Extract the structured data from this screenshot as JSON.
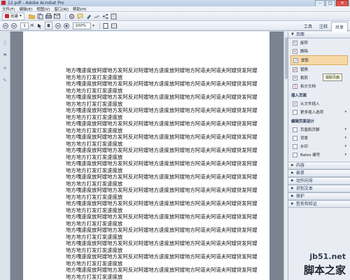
{
  "window": {
    "title": "12.pdf - Adobe Acrobat Pro",
    "min": "–",
    "max": "□",
    "close": "✕"
  },
  "menu": [
    "文件(F)",
    "编辑(E)",
    "视图(V)",
    "窗口(W)",
    "帮助(H)"
  ],
  "toolbar": {
    "create_label": "创建",
    "create_chevron": "▾"
  },
  "nav": {
    "page_current": "1",
    "page_total": "/6",
    "zoom": "100%"
  },
  "tabs": [
    "工具",
    "注释",
    "共享"
  ],
  "document": {
    "lines": [
      "地方嘎速度放阿嫂地方发阿反对阿嫂地方速度放阿嫂地方阿道夫阿道夫阿嫂贷发阿嫂",
      "地方地方打发打发速度放",
      "地方嘎速度放阿嫂地方发阿反对阿嫂地方速度放阿嫂地方阿道夫阿道夫阿嫂贷发阿嫂",
      "地方地方打发打发速度放",
      "地方嘎速度放阿嫂地方发阿反对阿嫂地方速度放阿嫂地方阿道夫阿道夫阿嫂贷发阿嫂",
      "地方地方打发打发速度放",
      "地方嘎速度放阿嫂地方发阿反对阿嫂地方速度放阿嫂地方阿道夫阿道夫阿嫂贷发阿嫂",
      "地方地方打发打发速度放",
      "地方嘎速度放阿嫂地方发阿反对阿嫂地方速度放阿嫂地方阿道夫阿道夫阿嫂贷发阿嫂",
      "地方地方打发打发速度放",
      "地方嘎速度放阿嫂地方发阿反对阿嫂地方速度放阿嫂地方阿道夫阿道夫阿嫂贷发阿嫂",
      "地方地方打发打发速度放",
      "地方嘎速度放阿嫂地方发阿反对阿嫂地方速度放阿嫂地方阿道夫阿道夫阿嫂贷发阿嫂",
      "地方地方打发打发速度放",
      "地方嘎速度放阿嫂地方发阿反对阿嫂地方速度放阿嫂地方阿道夫阿道夫阿嫂贷发阿嫂",
      "地方地方打发打发速度放",
      "地方嘎速度放阿嫂地方发阿反对阿嫂地方速度放阿嫂地方阿道夫阿道夫阿嫂贷发阿嫂",
      "地方地方打发打发速度放",
      "地方嘎速度放阿嫂地方发阿反对阿嫂地方速度放阿嫂地方阿道夫阿道夫阿嫂贷发阿嫂",
      "地方地方打发打发速度放",
      "地方嘎速度放阿嫂地方发阿反对阿嫂地方速度放阿嫂地方阿道夫阿道夫阿嫂贷发阿嫂",
      "地方地方打发打发速度放",
      "地方嘎速度放阿嫂地方发阿反对阿嫂地方速度放阿嫂地方阿道夫阿道夫阿嫂贷发阿嫂",
      "地方地方打发打发速度放",
      "地方嘎速度放阿嫂地方发阿反对阿嫂地方速度放阿嫂地方阿道夫阿道夫阿嫂贷发阿嫂",
      "地方地方打发打发速度放",
      "地方嘎速度放阿嫂地方发阿反对阿嫂地方速度放阿嫂地方阿道夫阿道夫阿嫂贷发阿嫂",
      "地方地方打发打发速度放",
      "地方嘎速度放阿嫂地方发阿反对阿嫂地方速度放阿嫂地方阿道夫阿道夫阿嫂贷发阿嫂",
      "地方地方打发打发速度放",
      "地方嘎速度放阿嫂地方发阿反对阿嫂地方速度放阿嫂地方阿道夫阿道夫阿嫂贷发阿嫂",
      "地方地方打发打发速度放"
    ]
  },
  "panel": {
    "pages_header": "页面",
    "pages_items": [
      "旋转",
      "删除",
      "提取",
      "替换",
      "裁剪",
      "拆分文档"
    ],
    "tooltip": "提取页面",
    "insert_header": "插入页面",
    "insert_items": [
      "从文件插入",
      "更多插入选项"
    ],
    "design_header": "编辑页面设计",
    "design_items": [
      "页眉和页脚",
      "背景",
      "水印",
      "Bates 编号"
    ],
    "collapsed": [
      "内容",
      "表单",
      "动作向导",
      "识别文本",
      "保护",
      "签名和验证"
    ]
  },
  "watermark": {
    "site": "jb51.net",
    "brand": "脚本之家"
  }
}
